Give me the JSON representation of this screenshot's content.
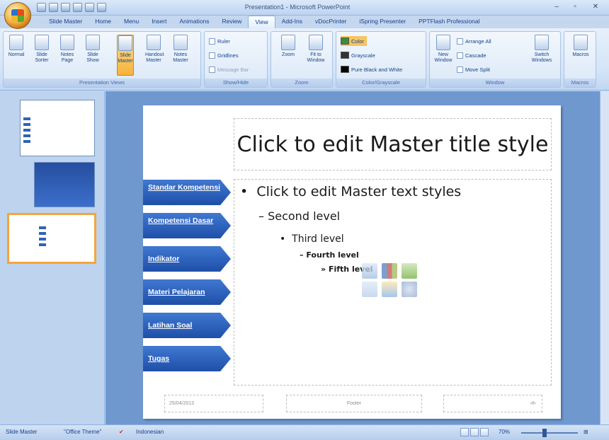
{
  "window": {
    "title": "Presentation1 - Microsoft PowerPoint"
  },
  "tabs": [
    "Slide Master",
    "Home",
    "Menu",
    "Insert",
    "Animations",
    "Review",
    "View",
    "Add-Ins",
    "vDocPrinter",
    "iSpring Presenter",
    "PPTFlash Professional"
  ],
  "active_tab": "View",
  "ribbon": {
    "presentation_views": {
      "label": "Presentation Views",
      "buttons": [
        "Normal",
        "Slide Sorter",
        "Notes Page",
        "Slide Show",
        "Slide Master",
        "Handout Master",
        "Notes Master"
      ],
      "active": "Slide Master"
    },
    "show_hide": {
      "label": "Show/Hide",
      "items": [
        "Ruler",
        "Gridlines",
        "Message Bar"
      ]
    },
    "zoom": {
      "label": "Zoom",
      "buttons": [
        "Zoom",
        "Fit to Window"
      ]
    },
    "color_grayscale": {
      "label": "Color/Grayscale",
      "items": [
        "Color",
        "Grayscale",
        "Pure Black and White"
      ]
    },
    "window": {
      "label": "Window",
      "new_window": "New Window",
      "items": [
        "Arrange All",
        "Cascade",
        "Move Split"
      ],
      "switch": "Switch Windows"
    },
    "macros": {
      "label": "Macros",
      "button": "Macros"
    }
  },
  "slide": {
    "title": "Click to edit Master title style",
    "levels": [
      "Click to edit Master text styles",
      "Second level",
      "Third level",
      "Fourth level",
      "Fifth level"
    ],
    "bullets": [
      "•",
      "–",
      "•",
      "–",
      "»"
    ],
    "nav_buttons": [
      "Standar Kompetensi",
      "Kompetensi Dasar",
      "Indikator",
      "Materi Pelajaran",
      "Latihan Soal",
      "Tugas"
    ],
    "footer": {
      "date": "25/04/2013",
      "footer": "Footer",
      "page": "‹#›"
    }
  },
  "status": {
    "view": "Slide Master",
    "theme": "\"Office Theme\"",
    "language": "Indonesian",
    "zoom": "70%"
  },
  "colors": {
    "nav": "#2b5fbd",
    "selected_thumb": "#f6a537",
    "ribbon": "#d4e4f7"
  }
}
